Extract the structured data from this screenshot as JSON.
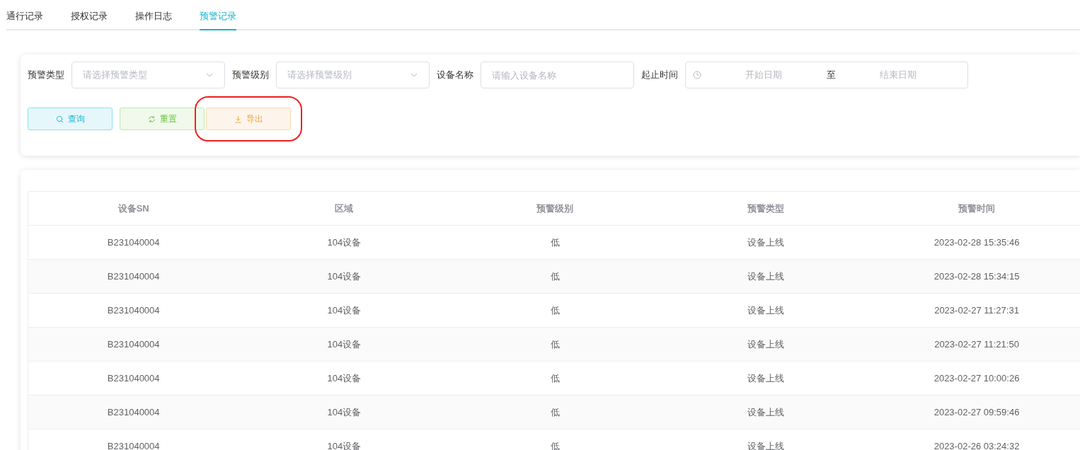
{
  "tabs": [
    {
      "label": "通行记录",
      "selected": false
    },
    {
      "label": "授权记录",
      "selected": false
    },
    {
      "label": "操作日志",
      "selected": false
    },
    {
      "label": "预警记录",
      "selected": true
    }
  ],
  "filters": [
    {
      "kind": "select",
      "label": "预警类型",
      "placeholder": "请选择预警类型"
    },
    {
      "kind": "select",
      "label": "预警级别",
      "placeholder": "请选择预警级别"
    },
    {
      "kind": "input",
      "label": "设备名称",
      "placeholder": "请输入设备名称"
    },
    {
      "kind": "daterange",
      "label": "起止时间",
      "start_placeholder": "开始日期",
      "separator": "至",
      "end_placeholder": "结束日期"
    }
  ],
  "buttons": [
    {
      "kind": "search",
      "label": "查询",
      "highlighted": false
    },
    {
      "kind": "reset",
      "label": "重置",
      "highlighted": false
    },
    {
      "kind": "export",
      "label": "导出",
      "highlighted": true
    }
  ],
  "table": {
    "columns": [
      "设备SN",
      "区域",
      "预警级别",
      "预警类型",
      "预警时间"
    ],
    "rows": [
      [
        "B231040004",
        "104设备",
        "低",
        "设备上线",
        "2023-02-28 15:35:46"
      ],
      [
        "B231040004",
        "104设备",
        "低",
        "设备上线",
        "2023-02-28 15:34:15"
      ],
      [
        "B231040004",
        "104设备",
        "低",
        "设备上线",
        "2023-02-27 11:27:31"
      ],
      [
        "B231040004",
        "104设备",
        "低",
        "设备上线",
        "2023-02-27 11:21:50"
      ],
      [
        "B231040004",
        "104设备",
        "低",
        "设备上线",
        "2023-02-27 10:00:26"
      ],
      [
        "B231040004",
        "104设备",
        "低",
        "设备上线",
        "2023-02-27 09:59:46"
      ],
      [
        "B231040004",
        "104设备",
        "低",
        "设备上线",
        "2023-02-26 03:24:32"
      ]
    ]
  }
}
